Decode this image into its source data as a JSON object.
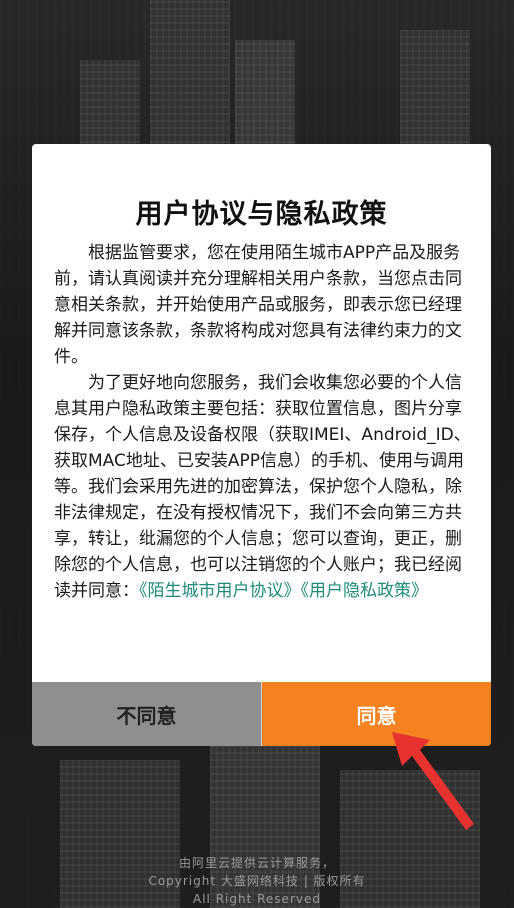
{
  "dialog": {
    "title": "用户协议与隐私政策",
    "paragraph1": "根据监管要求，您在使用陌生城市APP产品及服务前，请认真阅读并充分理解相关用户条款，当您点击同意相关条款，并开始使用产品或服务，即表示您已经理解并同意该条款，条款将构成对您具有法律约束力的文件。",
    "paragraph2": "为了更好地向您服务，我们会收集您必要的个人信息其用户隐私政策主要包括：获取位置信息，图片分享保存，个人信息及设备权限（获取IMEI、Android_ID、获取MAC地址、已安装APP信息）的手机、使用与调用等。我们会采用先进的加密算法，保护您个人隐私，除非法律规定，在没有授权情况下，我们不会向第三方共享，转让，纰漏您的个人信息；您可以查询，更正，删除您的个人信息，也可以注销您的个人账户；我已经阅读并同意：",
    "link_user_agreement": "《陌生城市用户协议》",
    "link_privacy_policy": "《用户隐私政策》",
    "disagree_label": "不同意",
    "agree_label": "同意"
  },
  "footer": {
    "line1": "由阿里云提供云计算服务，",
    "line2": "Copyright 大盛网络科技 | 版权所有",
    "line3": "All Right Reserved"
  },
  "colors": {
    "accent": "#f5821f",
    "link": "#1f8a7a",
    "disagree_bg": "#8f8f8f"
  }
}
